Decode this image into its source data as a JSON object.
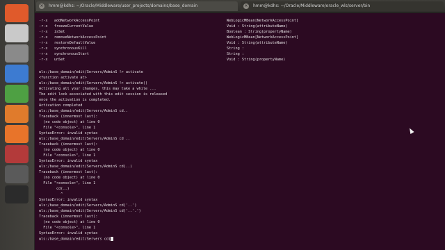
{
  "tabs": [
    {
      "title": "hmm@kdhs: ~/Oracle/Middleware/user_projects/domains/base_domain",
      "close_icon": "×"
    },
    {
      "title": "hmm@kdhs: ~/Oracle/Middleware/oracle_wls/server/bin",
      "close_icon": "×"
    }
  ],
  "launcher": [
    {
      "name": "dash-home-icon",
      "color": "#e05a2b"
    },
    {
      "name": "chrome-icon",
      "color": "#c9c9c9"
    },
    {
      "name": "files-icon",
      "color": "#8a8a8a"
    },
    {
      "name": "writer-icon",
      "color": "#3d7bd1"
    },
    {
      "name": "calc-icon",
      "color": "#4ea043"
    },
    {
      "name": "impress-icon",
      "color": "#e07b2c"
    },
    {
      "name": "software-center-icon",
      "color": "#e8742a"
    },
    {
      "name": "settings-icon",
      "color": "#b33a3a"
    },
    {
      "name": "ubuntu-one-icon",
      "color": "#5a5a5a"
    },
    {
      "name": "terminal-icon",
      "color": "#2b2b2b"
    }
  ],
  "terminal": {
    "listing": [
      {
        "left": "-r-x   addNetworkAccessPoint",
        "right": "WebLogicMBean[NetworkAccessPoint]"
      },
      {
        "left": "-r-x   freezeCurrentValue",
        "right": "Void : String(attributeName)"
      },
      {
        "left": "-r-x   isSet",
        "right": "Boolean : String(propertyName)"
      },
      {
        "left": "-r-x   removeNetworkAccessPoint",
        "right": "WebLogicMBean[NetworkAccessPoint]"
      },
      {
        "left": "-r-x   restoreDefaultValue",
        "right": "Void : String(attributeName)"
      },
      {
        "left": "-r-x   synchronousKill",
        "right": "String :"
      },
      {
        "left": "-r-x   synchronousStart",
        "right": "String :"
      },
      {
        "left": "-r-x   unSet",
        "right": "Void : String(propertyName)"
      }
    ],
    "output": [
      "wls:/base_domain/edit/Servers/AdminS !> activate",
      "<function activate at>",
      "wls:/base_domain/edit/Servers/AdminS !> activate()",
      "Activating all your changes, this may take a while ...",
      "The edit lock associated with this edit session is released",
      "once the activation is completed.",
      "Activation completed",
      "wls:/base_domain/edit/Servers/AdminS cd..",
      "Traceback (innermost last):",
      "  (no code object) at line 0",
      "  File \"<console>\", line 1",
      "SyntaxError: invalid syntax",
      "wls:/base_domain/edit/Servers/AdminS cd ..",
      "Traceback (innermost last):",
      "  (no code object) at line 0",
      "  File \"<console>\", line 1",
      "SyntaxError: invalid syntax",
      "wls:/base_domain/edit/Servers/AdminS cd(..)",
      "Traceback (innermost last):",
      "  (no code object) at line 0",
      "  File \"<console>\", line 1",
      "        cd(..)",
      "          ^",
      "SyntaxError: invalid syntax",
      "wls:/base_domain/edit/Servers/AdminS cd('..')",
      "wls:/base_domain/edit/Servers/AdminS cd('..'.')",
      "Traceback (innermost last):",
      "  (no code object) at line 0",
      "  File \"<console>\", line 1",
      "SyntaxError: invalid syntax",
      "wls:/base_domain/edit/Servers cd("
    ]
  }
}
